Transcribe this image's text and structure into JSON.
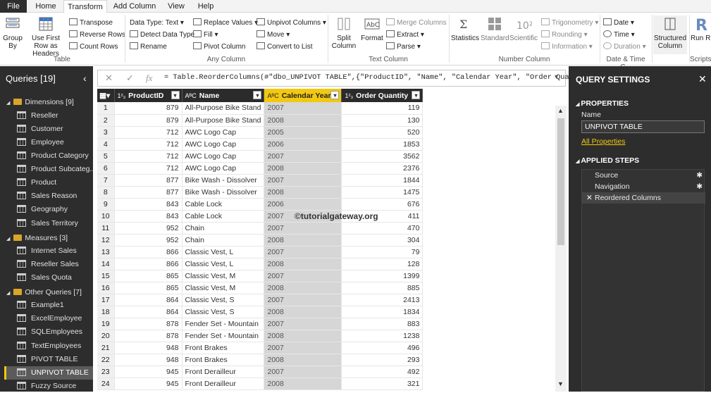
{
  "menu": {
    "file": "File",
    "home": "Home",
    "transform": "Transform",
    "add_column": "Add Column",
    "view": "View",
    "help": "Help"
  },
  "ribbon": {
    "table_group": {
      "label": "Table",
      "group_by": "Group By",
      "use_first_row": "Use First Row as Headers",
      "transpose": "Transpose",
      "reverse_rows": "Reverse Rows",
      "count_rows": "Count Rows"
    },
    "any_column_group": {
      "label": "Any Column",
      "data_type": "Data Type: Text",
      "detect_data_type": "Detect Data Type",
      "rename": "Rename",
      "replace_values": "Replace Values",
      "fill": "Fill",
      "pivot_column": "Pivot Column",
      "unpivot_columns": "Unpivot Columns",
      "move": "Move",
      "convert_to_list": "Convert to List"
    },
    "text_column_group": {
      "label": "Text Column",
      "split_column": "Split Column",
      "format": "Format",
      "merge_columns": "Merge Columns",
      "extract": "Extract",
      "parse": "Parse"
    },
    "number_column_group": {
      "label": "Number Column",
      "statistics": "Statistics",
      "standard": "Standard",
      "scientific": "Scientific",
      "trigonometry": "Trigonometry",
      "rounding": "Rounding",
      "information": "Information"
    },
    "datetime_group": {
      "label": "Date & Time C...",
      "date": "Date",
      "time": "Time",
      "duration": "Duration"
    },
    "structured_column": "Structured Column",
    "scripts_group": {
      "label": "Scripts",
      "run": "Run R Script"
    }
  },
  "queries": {
    "title": "Queries [19]",
    "groups": [
      {
        "label": "Dimensions [9]",
        "items": [
          "Reseller",
          "Customer",
          "Employee",
          "Product Category",
          "Product Subcateg...",
          "Product",
          "Sales Reason",
          "Geography",
          "Sales Territory"
        ]
      },
      {
        "label": "Measures [3]",
        "items": [
          "Internet Sales",
          "Reseller Sales",
          "Sales Quota"
        ]
      },
      {
        "label": "Other Queries [7]",
        "items": [
          "Example1",
          "ExcelEmployee",
          "SQLEmployees",
          "TextEmployees",
          "PIVOT TABLE",
          "UNPIVOT TABLE",
          "Fuzzy Source"
        ]
      }
    ],
    "selected": "UNPIVOT TABLE"
  },
  "formula_bar": {
    "formula": "= Table.ReorderColumns(#\"dbo_UNPIVOT TABLE\",{\"ProductID\", \"Name\", \"Calendar Year\", \"Order Quantity\"})"
  },
  "grid": {
    "columns": [
      {
        "type": "1²₃",
        "name": "ProductID"
      },
      {
        "type": "AᴮC",
        "name": "Name"
      },
      {
        "type": "AᴮC",
        "name": "Calendar Year"
      },
      {
        "type": "1²₃",
        "name": "Order Quantity"
      }
    ],
    "rows": [
      [
        879,
        "All-Purpose Bike Stand",
        "2007",
        119
      ],
      [
        879,
        "All-Purpose Bike Stand",
        "2008",
        130
      ],
      [
        712,
        "AWC Logo Cap",
        "2005",
        520
      ],
      [
        712,
        "AWC Logo Cap",
        "2006",
        1853
      ],
      [
        712,
        "AWC Logo Cap",
        "2007",
        3562
      ],
      [
        712,
        "AWC Logo Cap",
        "2008",
        2376
      ],
      [
        877,
        "Bike Wash - Dissolver",
        "2007",
        1844
      ],
      [
        877,
        "Bike Wash - Dissolver",
        "2008",
        1475
      ],
      [
        843,
        "Cable Lock",
        "2006",
        676
      ],
      [
        843,
        "Cable Lock",
        "2007",
        411
      ],
      [
        952,
        "Chain",
        "2007",
        470
      ],
      [
        952,
        "Chain",
        "2008",
        304
      ],
      [
        866,
        "Classic Vest, L",
        "2007",
        79
      ],
      [
        866,
        "Classic Vest, L",
        "2008",
        128
      ],
      [
        865,
        "Classic Vest, M",
        "2007",
        1399
      ],
      [
        865,
        "Classic Vest, M",
        "2008",
        885
      ],
      [
        864,
        "Classic Vest, S",
        "2007",
        2413
      ],
      [
        864,
        "Classic Vest, S",
        "2008",
        1834
      ],
      [
        878,
        "Fender Set - Mountain",
        "2007",
        883
      ],
      [
        878,
        "Fender Set - Mountain",
        "2008",
        1238
      ],
      [
        948,
        "Front Brakes",
        "2007",
        496
      ],
      [
        948,
        "Front Brakes",
        "2008",
        293
      ],
      [
        945,
        "Front Derailleur",
        "2007",
        492
      ],
      [
        945,
        "Front Derailleur",
        "2008",
        321
      ]
    ]
  },
  "watermark": "©tutorialgateway.org",
  "settings": {
    "title": "QUERY SETTINGS",
    "properties": "PROPERTIES",
    "name_label": "Name",
    "name_value": "UNPIVOT TABLE",
    "all_properties": "All Properties",
    "applied_steps": "APPLIED STEPS",
    "steps": [
      "Source",
      "Navigation",
      "Reordered Columns"
    ]
  }
}
